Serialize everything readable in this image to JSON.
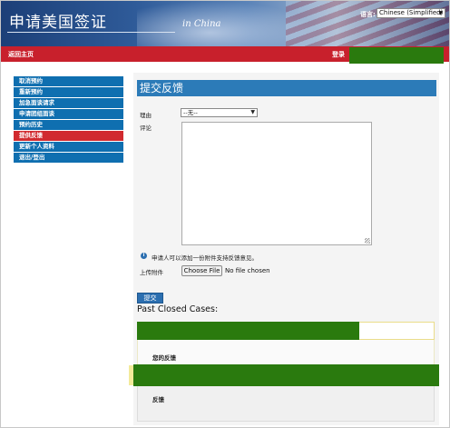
{
  "header": {
    "title": "申请美国签证",
    "subtitle": "in China",
    "language_label": "语言:",
    "language_value": "Chinese (Simplified)"
  },
  "navbar": {
    "home": "返回主页",
    "login": "登录"
  },
  "sidebar": {
    "items": [
      {
        "label": "取消预约"
      },
      {
        "label": "重新预约"
      },
      {
        "label": "加急面谈请求"
      },
      {
        "label": "申请团组面谈"
      },
      {
        "label": "预约历史"
      },
      {
        "label": "提供反馈",
        "active": true
      },
      {
        "label": "更新个人资料"
      },
      {
        "label": "退出/登出"
      }
    ]
  },
  "form": {
    "section_title": "提交反馈",
    "reason_label": "理由",
    "reason_value": "--无--",
    "comment_label": "评论",
    "info_text": "申请人可以添加一份附件支持反馈意见。",
    "attachment_label": "上传附件",
    "file_button": "Choose File",
    "file_status": "No file chosen",
    "submit": "提交"
  },
  "past_cases": {
    "title": "Past Closed Cases:",
    "your_feedback_label": "您的反馈",
    "feedback_label": "反馈"
  },
  "colors": {
    "nav_red": "#c8202c",
    "sidebar_blue": "#0f6fb0",
    "active_red": "#d12a2f",
    "section_blue": "#2c7bb8",
    "redaction_green": "#2a7a0e"
  }
}
